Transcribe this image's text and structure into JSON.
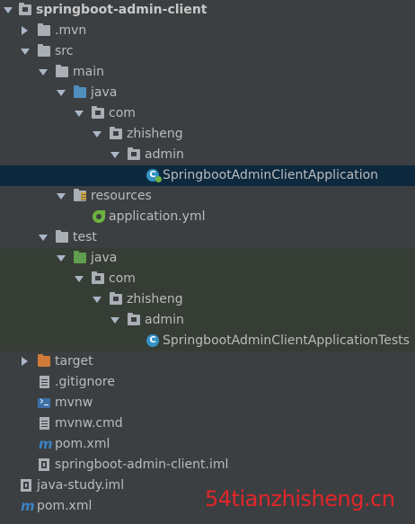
{
  "tree": {
    "root": "springboot-admin-client",
    "mvn": ".mvn",
    "src": "src",
    "main": "main",
    "java": "java",
    "com": "com",
    "zhisheng": "zhisheng",
    "admin": "admin",
    "app_class": "SpringbootAdminClientApplication",
    "resources": "resources",
    "app_yml": "application.yml",
    "test": "test",
    "test_java": "java",
    "test_com": "com",
    "test_zhisheng": "zhisheng",
    "test_admin": "admin",
    "test_class": "SpringbootAdminClientApplicationTests",
    "target": "target",
    "gitignore": ".gitignore",
    "mvnw": "mvnw",
    "mvnw_cmd": "mvnw.cmd",
    "pom": "pom.xml",
    "module_iml": "springboot-admin-client.iml",
    "java_study_iml": "java-study.iml",
    "root_pom": "pom.xml"
  },
  "watermark": "54tianzhisheng.cn",
  "colors": {
    "background": "#3c3f41",
    "selected_row": "#0d293e",
    "test_row": "#363d35",
    "text": "#bbbbbb",
    "watermark": "#e2262a"
  }
}
